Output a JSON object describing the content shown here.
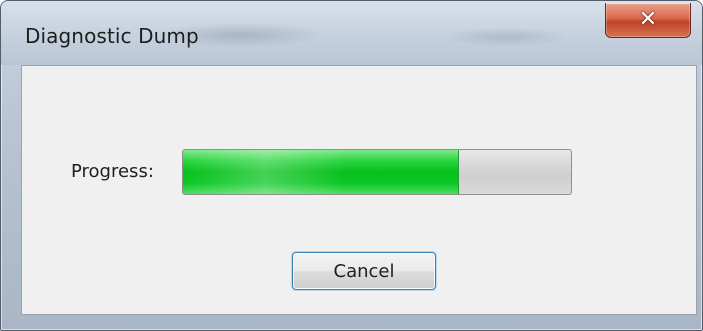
{
  "window": {
    "title": "Diagnostic Dump",
    "close_icon": "close-icon",
    "close_glyph": "✕"
  },
  "progress": {
    "label": "Progress:",
    "fraction": 0.71,
    "fill_color": "#06bf1c"
  },
  "buttons": {
    "cancel_label": "Cancel"
  }
}
